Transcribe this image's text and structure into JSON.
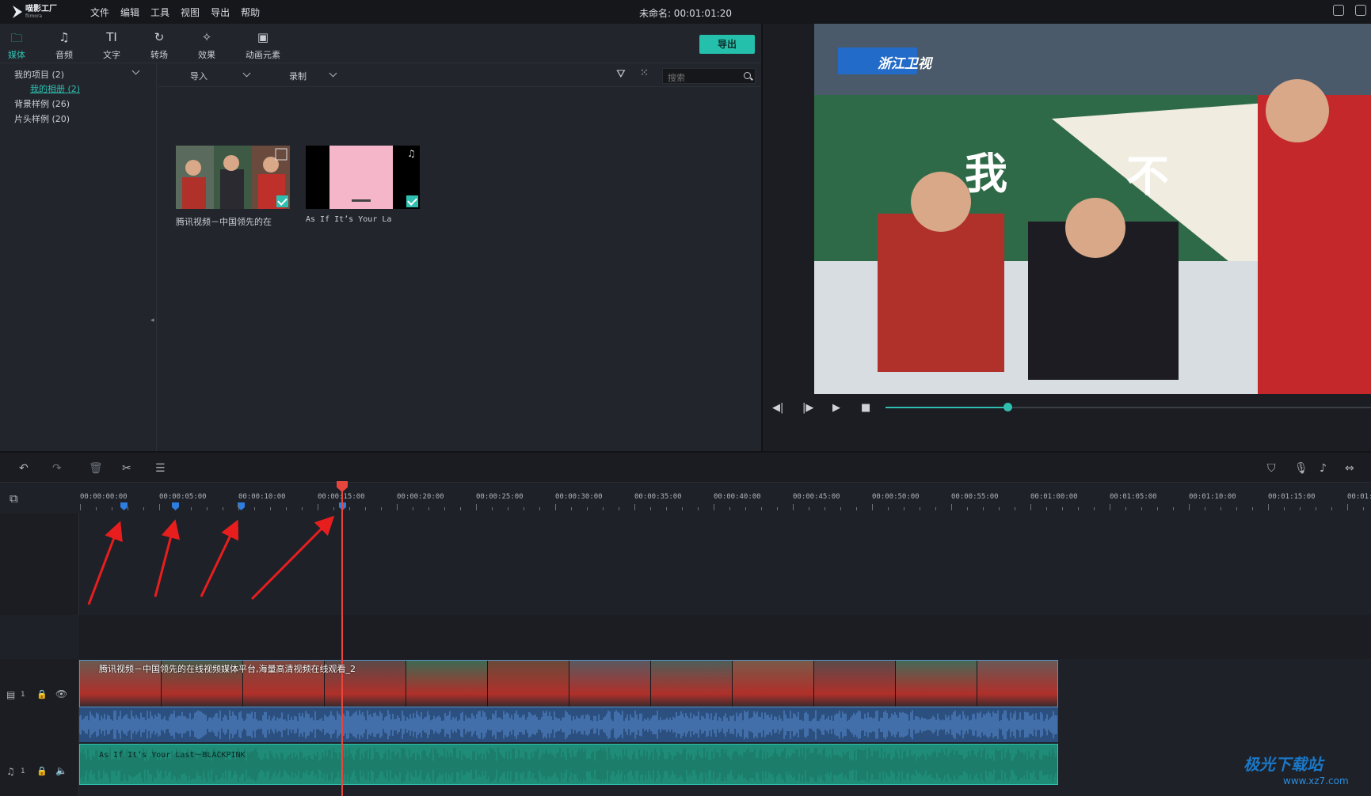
{
  "app": {
    "logo_text": "喵影工厂",
    "logo_sub": "filmora",
    "title": "未命名: 00:01:01:20"
  },
  "menu": [
    "文件",
    "编辑",
    "工具",
    "视图",
    "导出",
    "帮助"
  ],
  "tabs": [
    {
      "label": "媒体",
      "icon": "folder-icon"
    },
    {
      "label": "音频",
      "icon": "music-note-icon"
    },
    {
      "label": "文字",
      "icon": "text-icon"
    },
    {
      "label": "转场",
      "icon": "transition-icon"
    },
    {
      "label": "效果",
      "icon": "effects-icon"
    },
    {
      "label": "动画元素",
      "icon": "image-icon"
    }
  ],
  "export_label": "导出",
  "tree": {
    "my_project": "我的项目 (2)",
    "my_album": "我的相册 (2)",
    "bg_samples": "背景样例 (26)",
    "intro_samples": "片头样例 (20)"
  },
  "library": {
    "import_label": "导入",
    "record_label": "录制",
    "search_placeholder": "搜索"
  },
  "media_items": [
    {
      "name": "腾讯视频－中国领先的在"
    },
    {
      "name": "As  If  It’s  Your  La"
    }
  ],
  "preview": {
    "channel": "浙江卫视",
    "caption_left": "我",
    "caption_right": "不",
    "progress": 0.25
  },
  "ruler": [
    "00:00:00:00",
    "00:00:05:00",
    "00:00:10:00",
    "00:00:15:00",
    "00:00:20:00",
    "00:00:25:00",
    "00:00:30:00",
    "00:00:35:00",
    "00:00:40:00",
    "00:00:45:00",
    "00:00:50:00",
    "00:00:55:00",
    "00:01:00:00",
    "00:01:05:00",
    "00:01:10:00",
    "00:01:15:00",
    "00:01:"
  ],
  "timeline": {
    "video_track_label": "1",
    "audio_track_label": "1",
    "video_clip_title": "腾讯视频－中国领先的在线视频媒体平台,海量高清视频在线观看_2",
    "music_clip_title": "As  If  It’s  Your  Last－BLACKPINK"
  },
  "watermark": {
    "text": "极光下载站",
    "url": "www.xz7.com"
  }
}
